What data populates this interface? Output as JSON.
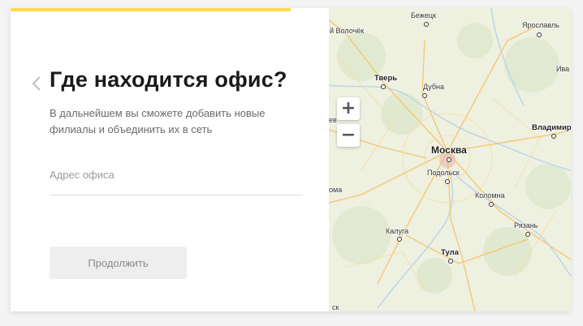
{
  "form": {
    "progress_percent": 50,
    "title": "Где находится офис?",
    "subtitle": "В дальнейшем вы сможете добавить новые филиалы и объединить их в сеть",
    "address_placeholder": "Адрес офиса",
    "address_value": "",
    "continue_label": "Продолжить"
  },
  "map": {
    "zoom_in": "+",
    "zoom_out": "−",
    "cities": {
      "bezhetsk": "Бежецк",
      "vyshny_volochek": "й Волочёк",
      "yaroslavl": "Ярославль",
      "ivanovo": "Ива",
      "tver": "Тверь",
      "dubna": "Дубна",
      "vladimir": "Владимир",
      "moscow": "Москва",
      "podolsk": "Подольск",
      "kolomna": "Коломна",
      "kaluga": "Калуга",
      "ryazan": "Рязань",
      "tula": "Тула",
      "edge_left_1": "ев",
      "edge_left_2": "ома",
      "edge_bottom": "ск"
    }
  },
  "colors": {
    "accent": "#ffdb4d",
    "map_land": "#eef0e0",
    "road": "#f5c56a",
    "water": "#b9d4ea"
  }
}
